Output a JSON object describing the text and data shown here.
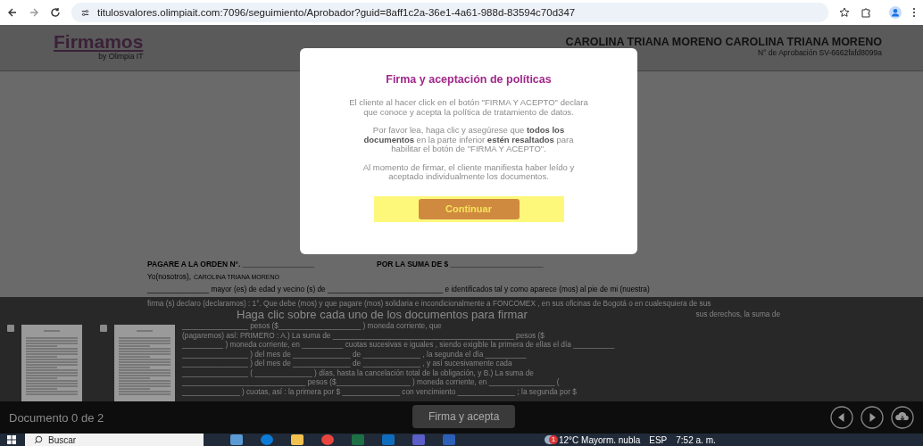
{
  "browser": {
    "url": "titulosvalores.olimpiait.com:7096/seguimiento/Aprobador?guid=8aff1c2a-36e1-4a61-988d-83594c70d347"
  },
  "header": {
    "logo": "Firmamos",
    "logo_sub": "by Olimpia IT",
    "user_name": "CAROLINA TRIANA MORENO CAROLINA TRIANA MORENO",
    "approval": "N° de Aprobación SV-6662fafd8099a"
  },
  "document": {
    "title_left": "PAGARE A LA ORDEN N°. _________________",
    "title_right": "POR LA SUMA DE $ ______________________",
    "debtor_label": "Yo(nosotros),",
    "debtor_name": "CAROLINA TRIANA MORENO",
    "line_2": "_______________ mayor (es) de edad y vecino (s) de ____________________________ e identificados tal y como aparece (mos) al pie de mi (nuestra)",
    "line_3": "firma (s) declaro (declaramos) : 1°. Que debe (mos) y que pagare (mos) solidaria e incondicionalmente a FONCOMEX , en sus oficinas de Bogotá o en cualesquiera de sus",
    "lower_lines": [
      "sus derechos, la suma de",
      "________________ pesos ($____________________ ) moneda corriente, que",
      "(pagaremos) así: PRIMERO : A.) La suma de ____________________________________________ pesos ($",
      "__________ ) moneda corriente, en __________ cuotas sucesivas e iguales , siendo exigible la primera de ellas el día __________",
      "________________ ) del mes de ______________ de ______________ , la segunda el día __________",
      "________________ ) del mes de ______________ de ______________ , y así sucesivamente cada",
      "________________ ( ______________ ) días, hasta la cancelación total de la obligación, y B.) La suma de",
      "______________________________ pesos ($__________________ ) moneda corriente, en ________________ (",
      "______________ ) cuotas, así : la primera por $ ______________ con vencimiento ______________ ; la segunda por $"
    ]
  },
  "panel": {
    "instruction": "Haga clic sobre cada uno de los documentos para firmar",
    "thumbnails": [
      {
        "checked": false
      },
      {
        "checked": false
      }
    ]
  },
  "footer": {
    "counter": "Documento 0 de 2",
    "sign_button": "Firma y acepta"
  },
  "modal": {
    "title": "Firma y aceptación de políticas",
    "paragraphs": [
      "El cliente al hacer click en el botón \"FIRMA Y ACEPTO\" declara que conoce y acepta la política de tratamiento de datos.",
      "Por favor lea, haga clic y asegúrese que **todos los documentos** en la parte inferior **estén resaltados** para habilitar el botón de \"FIRMA Y ACEPTO\".",
      "Al momento de firmar, el cliente manifiesta haber leído y aceptado individualmente los documentos."
    ],
    "button": "Continuar"
  },
  "taskbar": {
    "search_placeholder": "Buscar",
    "notification_badge": "1",
    "weather": "12°C  Mayorm. nubla",
    "language": "ESP",
    "time": "7:52 a. m."
  }
}
